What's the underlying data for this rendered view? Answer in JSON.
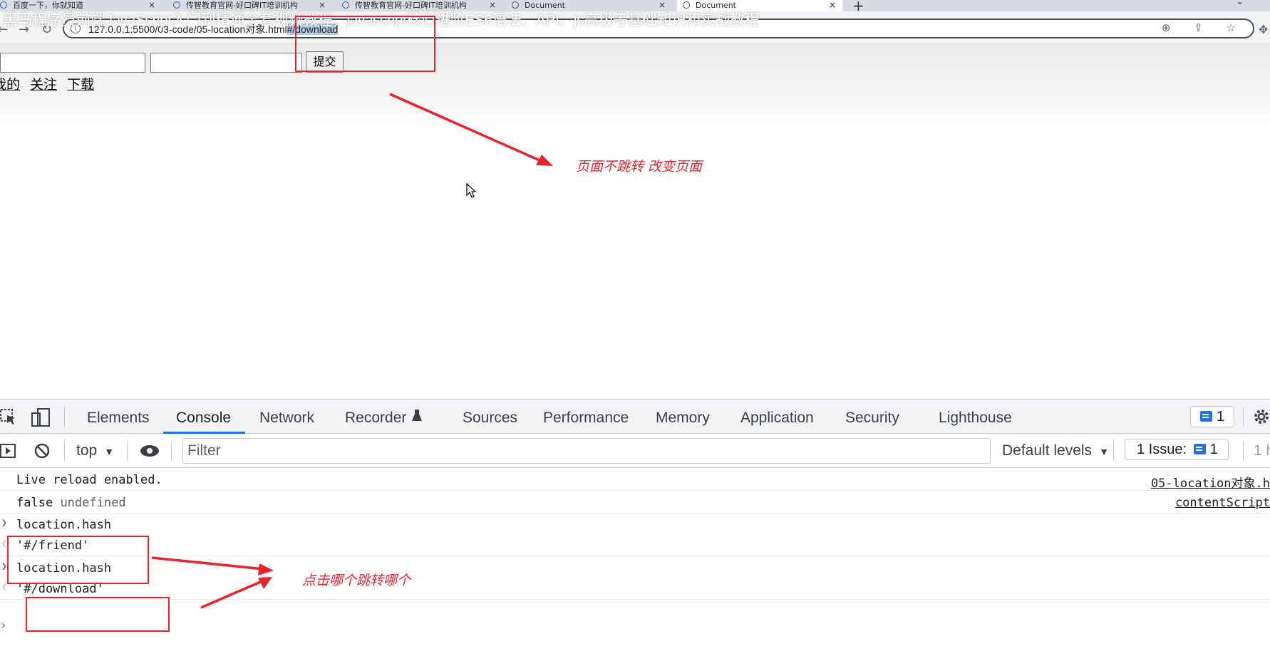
{
  "browser": {
    "tabs": [
      {
        "title": "百度一下，你就知道",
        "close": "×"
      },
      {
        "title": "传智教育官网-好口碑IT培训机构",
        "close": "×"
      },
      {
        "title": "传智教育官网-好口碑IT培训机构",
        "close": "×"
      },
      {
        "title": "Document",
        "close": "×"
      },
      {
        "title": "Document",
        "close": "×"
      }
    ],
    "new_tab": "+",
    "tab_overflow": "⌄",
    "nav": {
      "back": "←",
      "forward": "→",
      "reload": "↻"
    },
    "url_base": "127.0.0.1:5500/03-code/05-location对象.html",
    "url_hash": "#/download",
    "url_actions": "⊕ ⇪ ☆"
  },
  "overlay_title": "黑马程序员前端JavaScript入门到精通全套视频教程，javascript核心进阶ES6语法、API、js高级等基础知识和实战教程",
  "page": {
    "submit_label": "提交",
    "links": [
      "我的",
      "关注",
      "下载"
    ]
  },
  "annotations": {
    "note_top": "页面不跳转  改变页面",
    "note_bottom": "点击哪个跳转哪个",
    "color": "#e8232b"
  },
  "devtools": {
    "tabs": [
      "Elements",
      "Console",
      "Network",
      "Recorder",
      "Sources",
      "Performance",
      "Memory",
      "Application",
      "Security",
      "Lighthouse"
    ],
    "active_tab": "Console",
    "recorder_icon": "flask-icon",
    "messages_badge": "1",
    "context": "top",
    "filter_placeholder": "Filter",
    "levels": "Default levels",
    "issues_label": "1 Issue:",
    "issues_count": "1",
    "hidden_count": "1 h",
    "console_lines": [
      {
        "text": "Live reload enabled.",
        "source": "05-location对象.h"
      },
      {
        "text": "false",
        "extra": "undefined",
        "source": "contentScript"
      },
      {
        "text": "location.hash"
      },
      {
        "text": "'#/friend'"
      },
      {
        "text": "location.hash"
      },
      {
        "text": "'#/download'"
      }
    ],
    "prompt": "›"
  }
}
